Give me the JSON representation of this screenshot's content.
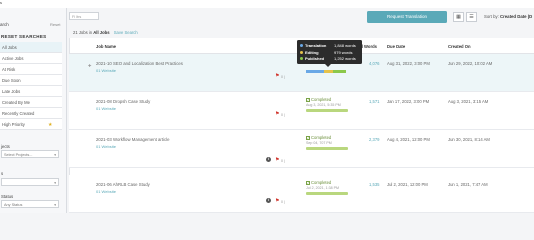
{
  "topbar": {
    "title": "s"
  },
  "sidebar": {
    "search_label": "arch",
    "reset_label": "Reset",
    "section_title": "RESET SEARCHES",
    "items": [
      {
        "label": "All Jobs",
        "active": true,
        "star": false
      },
      {
        "label": "Active Jobs",
        "active": false,
        "star": false
      },
      {
        "label": "At Risk",
        "active": false,
        "star": false
      },
      {
        "label": "Due Soon",
        "active": false,
        "star": false
      },
      {
        "label": "Late Jobs",
        "active": false,
        "star": false
      },
      {
        "label": "Created By Me",
        "active": false,
        "star": false
      },
      {
        "label": "Recently Created",
        "active": false,
        "star": false
      },
      {
        "label": "High Priority",
        "active": false,
        "star": true
      }
    ],
    "groups": [
      {
        "title": "jects",
        "select_placeholder": "Select Projects..."
      },
      {
        "title": "s",
        "select_placeholder": ""
      },
      {
        "title": "Status",
        "select_placeholder": "Any Status"
      }
    ]
  },
  "toolbar": {
    "filter_placeholder": "Fi ltrs",
    "request_button": "Request Translation",
    "sort_label": "Sort by:",
    "sort_value": "Created Date (D"
  },
  "summary": {
    "prefix": "21 Jobs in",
    "scope": "All Jobs",
    "link": "Save Search"
  },
  "table": {
    "headers": {
      "job_name": "Job Name",
      "words": "tal Words",
      "due_date": "Due Date",
      "created_on": "Created On"
    },
    "rows": [
      {
        "name": "2021-10 SEO and Localization Best Practices",
        "client": "01 Website",
        "status": "",
        "status_date": "",
        "words": "4,076",
        "due": "Aug 31, 2022, 3:00 PM",
        "created": "Jun 29, 2022, 10:02 AM",
        "count": "0 |",
        "highlight": true,
        "show_info": false
      },
      {
        "name": "2021-08 Dropsh Case Study",
        "client": "01 Website",
        "status": "Completed",
        "status_date": "Aug 3, 2021, 5:35 PM",
        "words": "1,571",
        "due": "Jan 17, 2022, 3:00 PM",
        "created": "Aug 3, 2021, 3:15 AM",
        "count": "0 |",
        "highlight": false,
        "show_info": false
      },
      {
        "name": "2021-03 Workflow Management article",
        "client": "01 Website",
        "status": "Completed",
        "status_date": "Sep 04, 707 PM",
        "words": "2,379",
        "due": "Aug 4, 2021, 12:00 PM",
        "created": "Jun 30, 2021, 8:14 AM",
        "count": "0 |",
        "highlight": false,
        "show_info": true
      },
      {
        "name": "2021-06 AhRLB Case Study",
        "client": "01 Website",
        "status": "Completed",
        "status_date": "Jul 2, 2021, 1:38 PM",
        "words": "1,535",
        "due": "Jul 2, 2021, 12:00 PM",
        "created": "Jun 1, 2021, 7:47 AM",
        "count": "0 |",
        "highlight": false,
        "show_info": true
      }
    ]
  },
  "tooltip": {
    "lines": [
      {
        "label": "Translation",
        "value": "1,848 words",
        "color": "#6aa8e6"
      },
      {
        "label": "Editing",
        "value": "979 words",
        "color": "#e6c24a"
      },
      {
        "label": "Published",
        "value": "1,252 words",
        "color": "#8cc84b"
      }
    ]
  },
  "colors": {
    "accent": "#5aa9b8",
    "completed": "#6b8f3a",
    "flag": "#d0342c"
  },
  "icons": [
    "chevron-down-icon",
    "grid-view-icon",
    "list-view-icon",
    "star-icon",
    "info-icon",
    "flag-icon",
    "checkbox-icon"
  ]
}
